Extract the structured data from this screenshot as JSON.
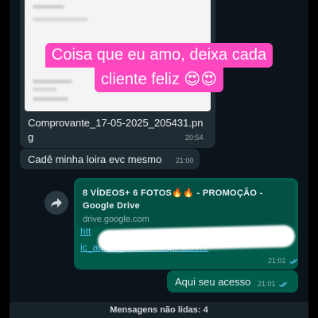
{
  "overlay": {
    "caption_line1": "Coisa que eu amo, deixa cada",
    "caption_line2": "cliente feliz 😍😍",
    "caption_color": "#ff47c0"
  },
  "messages": {
    "image_message": {
      "file_name": "Comprovante_17-05-2025_205431.png",
      "time": "20:54"
    },
    "text_message": {
      "text": "Cadê minha loira evc mesmo",
      "time": "21:00"
    },
    "link_message": {
      "preview_title": "8 VÍDEOS+ 6 FOTOS🔥🔥 - PROMOÇÃO  - Google Drive",
      "preview_domain": "drive.google.com",
      "url_start": "htt",
      "url_end": "ic_aqlOs_vxF5RFnmpPOlXlvl/",
      "time": "21:01",
      "forward_icon": "forward-icon"
    },
    "access_message": {
      "text": "Aqui seu acesso",
      "time": "21:01"
    }
  },
  "divider": {
    "unread_label": "Mensagens não lidas: 4"
  },
  "colors": {
    "chat_background": "#0b141a",
    "incoming_bubble": "#202c33",
    "outgoing_bubble": "#005c4b",
    "link_color": "#53bdeb",
    "read_tick": "#53bdeb"
  }
}
